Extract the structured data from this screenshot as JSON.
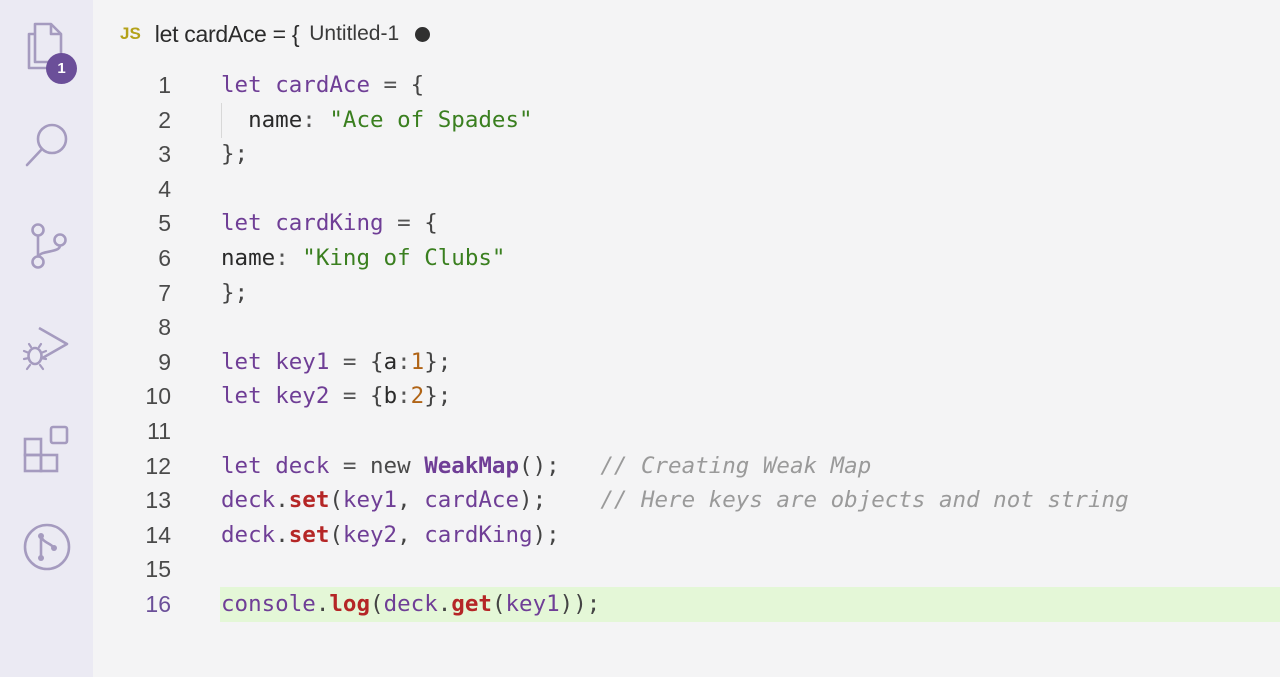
{
  "activity_bar": {
    "items": [
      {
        "name": "explorer",
        "icon": "files-icon",
        "badge": "1"
      },
      {
        "name": "search",
        "icon": "search-icon"
      },
      {
        "name": "source-control",
        "icon": "source-control-icon"
      },
      {
        "name": "run-and-debug",
        "icon": "run-debug-icon"
      },
      {
        "name": "extensions",
        "icon": "extensions-icon"
      },
      {
        "name": "github",
        "icon": "git-pull-request-icon"
      }
    ]
  },
  "tab": {
    "language_badge": "JS",
    "title": "let cardAce = {",
    "description": "Untitled-1",
    "dirty": true
  },
  "editor": {
    "active_line": 16,
    "lines": [
      {
        "number": "1",
        "tokens": [
          [
            "k",
            "let"
          ],
          [
            "p",
            " "
          ],
          [
            "v",
            "cardAce"
          ],
          [
            "o",
            " = "
          ],
          [
            "p",
            "{"
          ]
        ]
      },
      {
        "number": "2",
        "indent": true,
        "tokens": [
          [
            "p",
            "  "
          ],
          [
            "prop",
            "name"
          ],
          [
            "o",
            ": "
          ],
          [
            "s",
            "\"Ace of Spades\""
          ]
        ]
      },
      {
        "number": "3",
        "tokens": [
          [
            "p",
            "};"
          ]
        ]
      },
      {
        "number": "4",
        "tokens": []
      },
      {
        "number": "5",
        "tokens": [
          [
            "k",
            "let"
          ],
          [
            "p",
            " "
          ],
          [
            "v",
            "cardKing"
          ],
          [
            "o",
            " = "
          ],
          [
            "p",
            "{"
          ]
        ]
      },
      {
        "number": "6",
        "tokens": [
          [
            "prop",
            "name"
          ],
          [
            "o",
            ": "
          ],
          [
            "s",
            "\"King of Clubs\""
          ]
        ]
      },
      {
        "number": "7",
        "tokens": [
          [
            "p",
            "};"
          ]
        ]
      },
      {
        "number": "8",
        "tokens": []
      },
      {
        "number": "9",
        "tokens": [
          [
            "k",
            "let"
          ],
          [
            "p",
            " "
          ],
          [
            "v",
            "key1"
          ],
          [
            "o",
            " = "
          ],
          [
            "p",
            "{"
          ],
          [
            "prop",
            "a"
          ],
          [
            "o",
            ":"
          ],
          [
            "n",
            "1"
          ],
          [
            "p",
            "};"
          ]
        ]
      },
      {
        "number": "10",
        "tokens": [
          [
            "k",
            "let"
          ],
          [
            "p",
            " "
          ],
          [
            "v",
            "key2"
          ],
          [
            "o",
            " = "
          ],
          [
            "p",
            "{"
          ],
          [
            "prop",
            "b"
          ],
          [
            "o",
            ":"
          ],
          [
            "n",
            "2"
          ],
          [
            "p",
            "};"
          ]
        ]
      },
      {
        "number": "11",
        "tokens": []
      },
      {
        "number": "12",
        "tokens": [
          [
            "k",
            "let"
          ],
          [
            "p",
            " "
          ],
          [
            "v",
            "deck"
          ],
          [
            "o",
            " = "
          ],
          [
            "kw2",
            "new"
          ],
          [
            "p",
            " "
          ],
          [
            "cls",
            "WeakMap"
          ],
          [
            "p",
            "();   "
          ],
          [
            "c",
            "// Creating Weak Map"
          ]
        ]
      },
      {
        "number": "13",
        "tokens": [
          [
            "v",
            "deck"
          ],
          [
            "p",
            "."
          ],
          [
            "fn",
            "set"
          ],
          [
            "p",
            "("
          ],
          [
            "v",
            "key1"
          ],
          [
            "p",
            ", "
          ],
          [
            "v",
            "cardAce"
          ],
          [
            "p",
            ");    "
          ],
          [
            "c",
            "// Here keys are objects and not string"
          ]
        ]
      },
      {
        "number": "14",
        "tokens": [
          [
            "v",
            "deck"
          ],
          [
            "p",
            "."
          ],
          [
            "fn",
            "set"
          ],
          [
            "p",
            "("
          ],
          [
            "v",
            "key2"
          ],
          [
            "p",
            ", "
          ],
          [
            "v",
            "cardKing"
          ],
          [
            "p",
            ");"
          ]
        ]
      },
      {
        "number": "15",
        "tokens": []
      },
      {
        "number": "16",
        "tokens": [
          [
            "v",
            "console"
          ],
          [
            "p",
            "."
          ],
          [
            "fn",
            "log"
          ],
          [
            "p",
            "("
          ],
          [
            "v",
            "deck"
          ],
          [
            "p",
            "."
          ],
          [
            "fn",
            "get"
          ],
          [
            "p",
            "("
          ],
          [
            "v",
            "key1"
          ],
          [
            "p",
            "));"
          ]
        ]
      }
    ]
  },
  "colors": {
    "activity_bar_bg": "#ebeaf3",
    "editor_bg": "#f4f4f5",
    "active_line_bg": "#e4f7d7",
    "badge_bg": "#6b4f99",
    "keyword": "#6f3e96",
    "string": "#3a7f1f",
    "number": "#b06416",
    "function": "#b52626",
    "comment": "#9a9a9a"
  }
}
